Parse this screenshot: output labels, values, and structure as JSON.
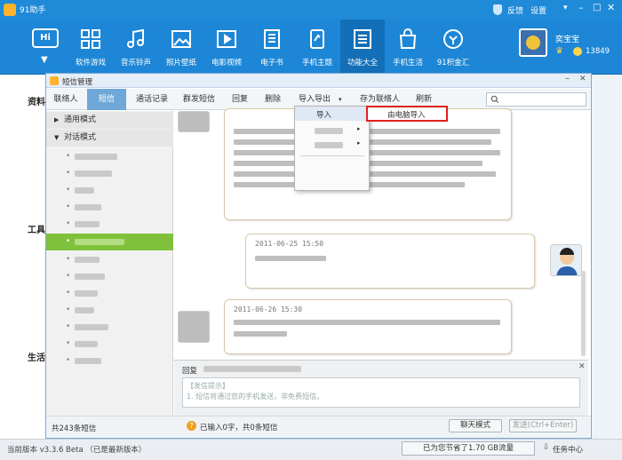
{
  "app": {
    "title": "91助手",
    "user_name": "奕宝宝",
    "coins": "13849",
    "right_links": [
      "反馈",
      "设置"
    ]
  },
  "toolbar": {
    "items": [
      {
        "label": "软件游戏",
        "icon": "apps-grid-icon"
      },
      {
        "label": "音乐铃声",
        "icon": "music-note-icon"
      },
      {
        "label": "照片壁纸",
        "icon": "photo-icon"
      },
      {
        "label": "电影视频",
        "icon": "video-icon"
      },
      {
        "label": "电子书",
        "icon": "ebook-icon"
      },
      {
        "label": "手机主题",
        "icon": "theme-icon"
      },
      {
        "label": "功能大全",
        "icon": "functions-icon"
      },
      {
        "label": "手机生活",
        "icon": "shopping-bag-icon"
      },
      {
        "label": "91积金汇",
        "icon": "coin-icon"
      }
    ],
    "active_index": 6,
    "hi_label": "Hi"
  },
  "left_strip": {
    "labels": [
      "资料",
      "工具",
      "生活"
    ]
  },
  "sms_window": {
    "title": "短信管理"
  },
  "tabs": [
    "联络人",
    "短信",
    "通话记录"
  ],
  "actions": {
    "bulk_send": "群发短信",
    "reply": "回复",
    "delete": "删除",
    "import_export": "导入导出",
    "save_contact": "存为联络人",
    "refresh": "刷新"
  },
  "tree": {
    "general_mode": "通用模式",
    "dialog_mode": "对话模式"
  },
  "dropdown": {
    "import": "导入",
    "from_pc_import": "由电脑导入"
  },
  "messages": [
    {
      "time": "2011-06-25 15:50"
    },
    {
      "time": "2011-06-26 15:30"
    }
  ],
  "reply": {
    "label": "回复",
    "hint_title": "【发信提示】",
    "hint": "1. 短信将通过您的手机发送，非免费短信。",
    "count_text": "已输入0字，共0条短信",
    "chat_mode": "聊天模式",
    "send": "发送(Ctrl+Enter)"
  },
  "status": {
    "total": "共243条短信",
    "version": "当前版本 v3.3.6 Beta （已是最新版本）",
    "traffic": "已为您节省了1.70 GB流量",
    "task_center": "任务中心"
  },
  "colors": {
    "accent": "#1d86d6",
    "selected": "#7fc13a",
    "highlight": "#e02020"
  }
}
